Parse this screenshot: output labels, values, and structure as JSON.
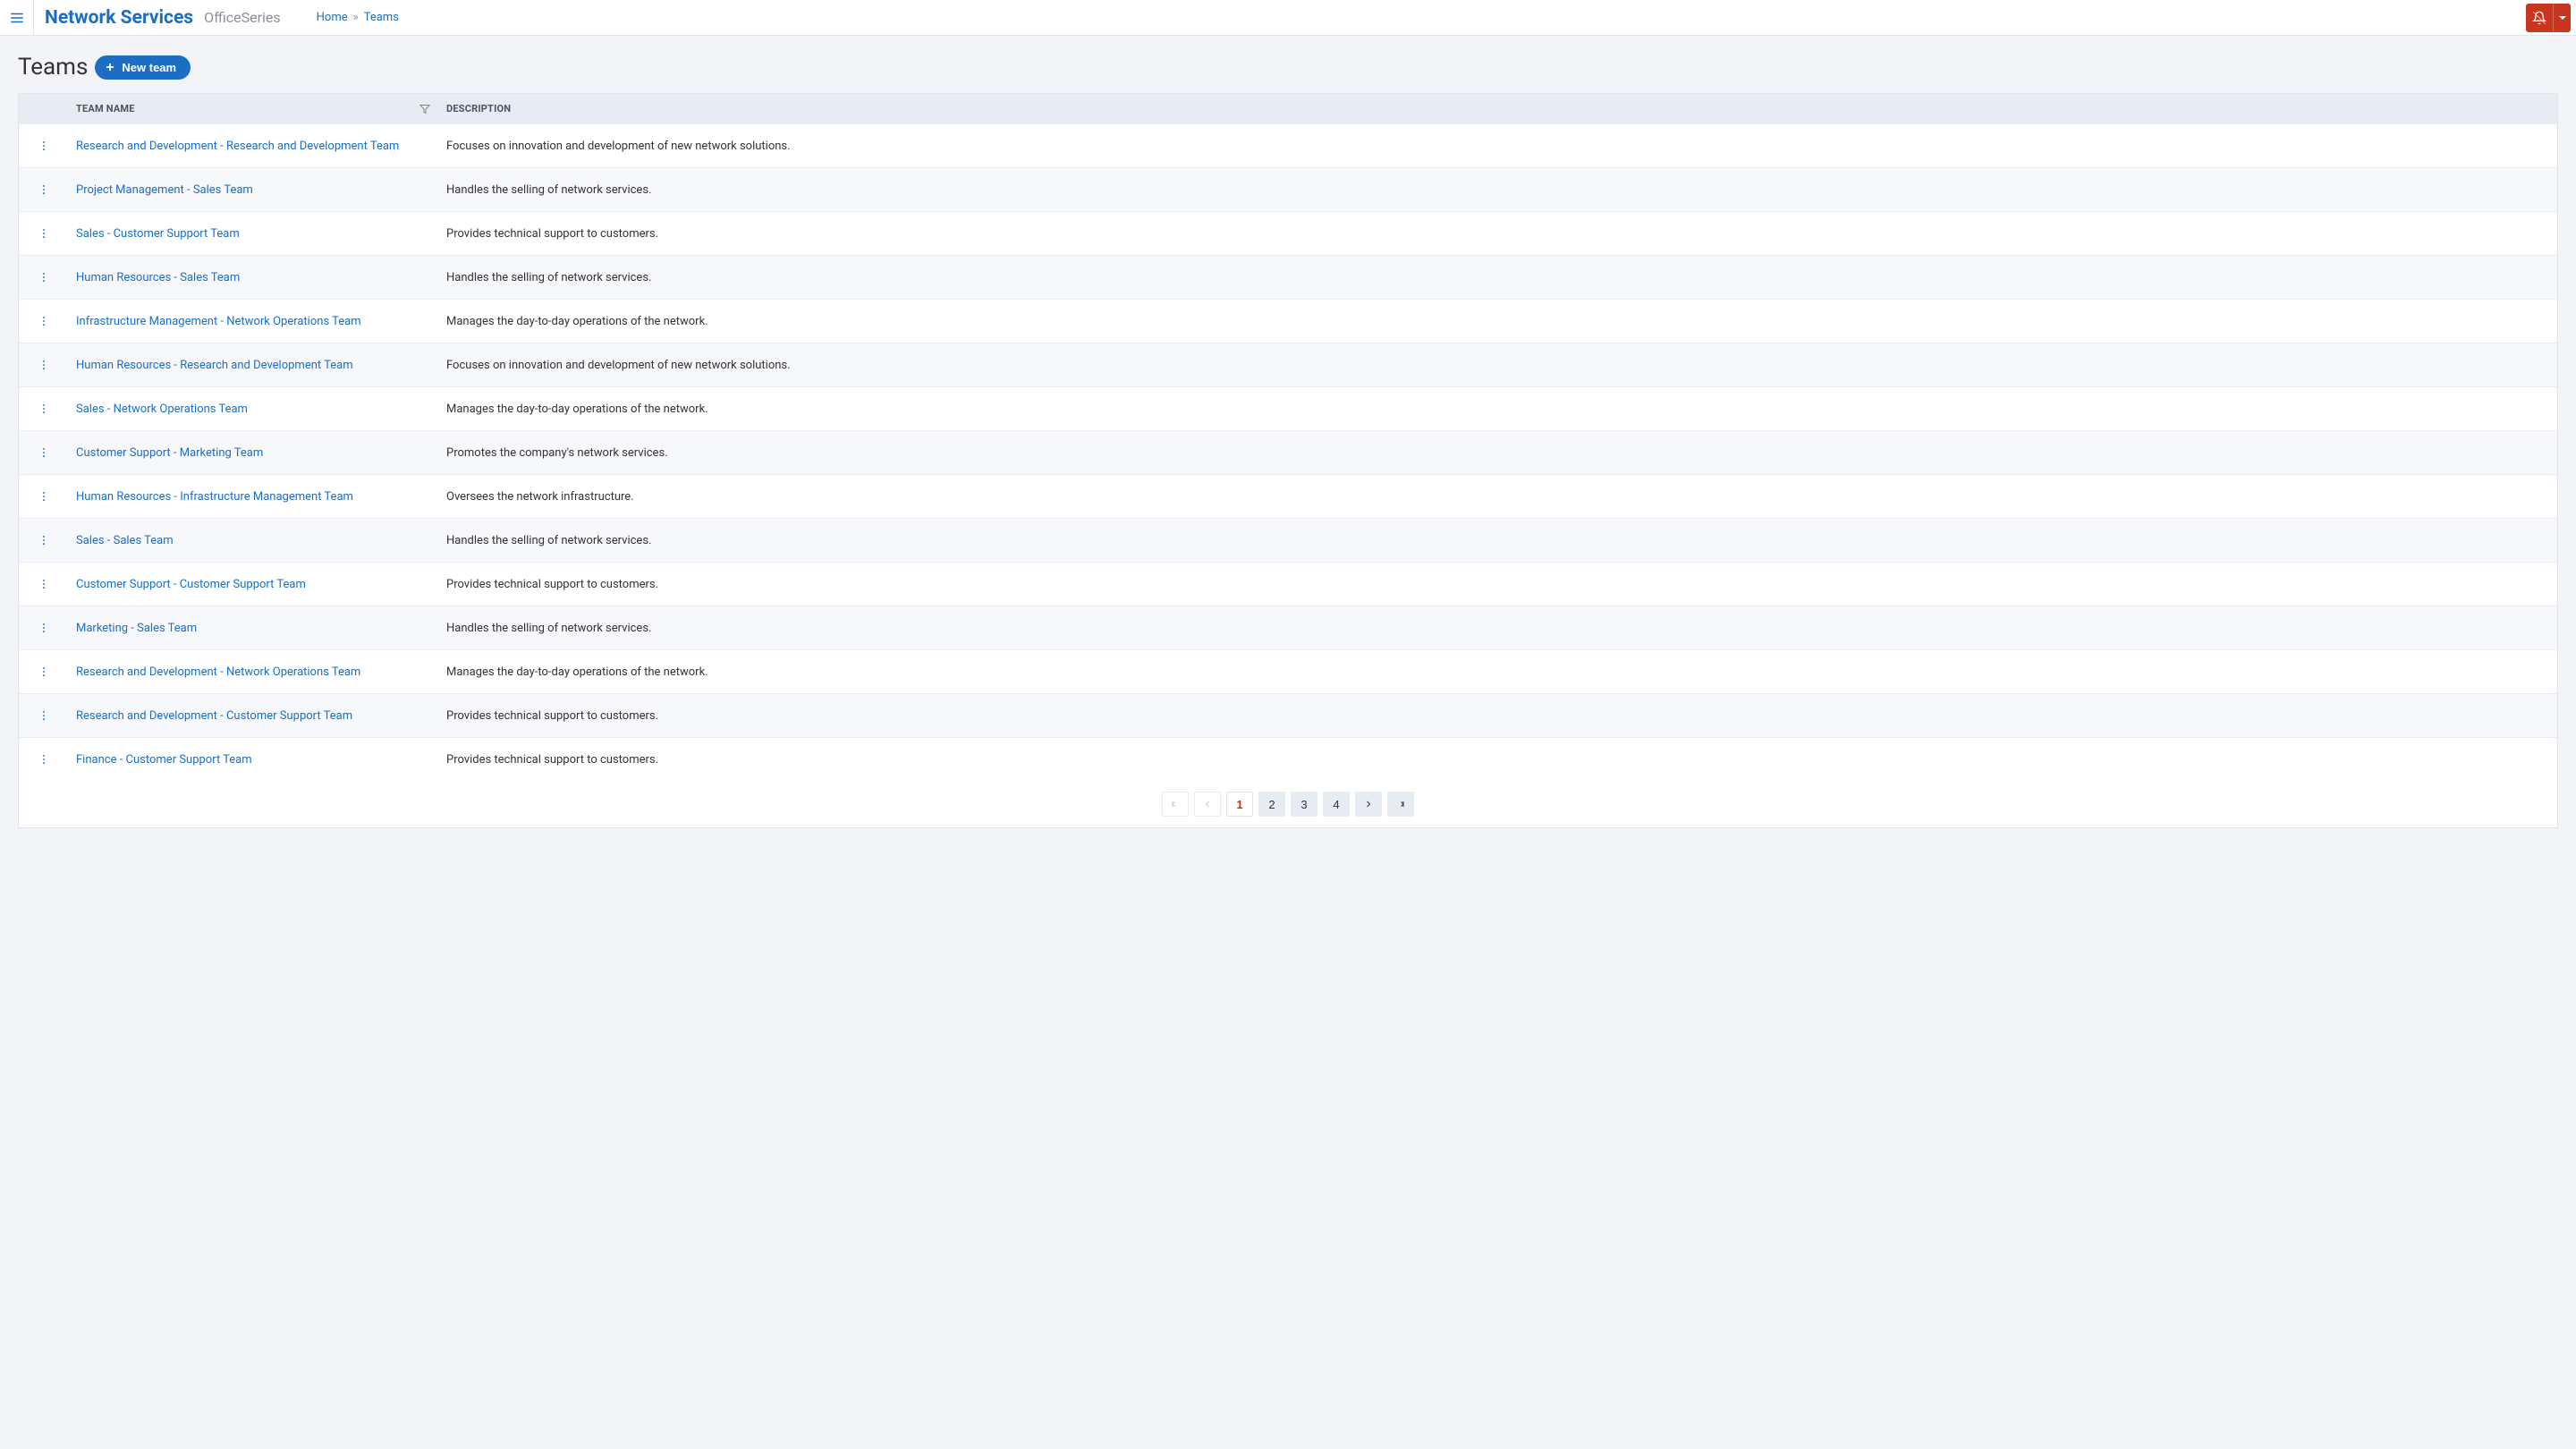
{
  "header": {
    "app_title": "Network Services",
    "app_subtitle": "OfficeSeries",
    "breadcrumb": {
      "home": "Home",
      "sep": "»",
      "current": "Teams"
    }
  },
  "page": {
    "title": "Teams",
    "new_button": "New team"
  },
  "table": {
    "columns": {
      "team_name": "Team Name",
      "description": "Description"
    },
    "rows": [
      {
        "name": "Research and Development - Research and Development Team",
        "description": "Focuses on innovation and development of new network solutions."
      },
      {
        "name": "Project Management - Sales Team",
        "description": "Handles the selling of network services."
      },
      {
        "name": "Sales - Customer Support Team",
        "description": "Provides technical support to customers."
      },
      {
        "name": "Human Resources - Sales Team",
        "description": "Handles the selling of network services."
      },
      {
        "name": "Infrastructure Management - Network Operations Team",
        "description": "Manages the day-to-day operations of the network."
      },
      {
        "name": "Human Resources - Research and Development Team",
        "description": "Focuses on innovation and development of new network solutions."
      },
      {
        "name": "Sales - Network Operations Team",
        "description": "Manages the day-to-day operations of the network."
      },
      {
        "name": "Customer Support - Marketing Team",
        "description": "Promotes the company's network services."
      },
      {
        "name": "Human Resources - Infrastructure Management Team",
        "description": "Oversees the network infrastructure."
      },
      {
        "name": "Sales - Sales Team",
        "description": "Handles the selling of network services."
      },
      {
        "name": "Customer Support - Customer Support Team",
        "description": "Provides technical support to customers."
      },
      {
        "name": "Marketing - Sales Team",
        "description": "Handles the selling of network services."
      },
      {
        "name": "Research and Development - Network Operations Team",
        "description": "Manages the day-to-day operations of the network."
      },
      {
        "name": "Research and Development - Customer Support Team",
        "description": "Provides technical support to customers."
      },
      {
        "name": "Finance - Customer Support Team",
        "description": "Provides technical support to customers."
      }
    ]
  },
  "pagination": {
    "pages": [
      "1",
      "2",
      "3",
      "4"
    ],
    "current": "1"
  }
}
